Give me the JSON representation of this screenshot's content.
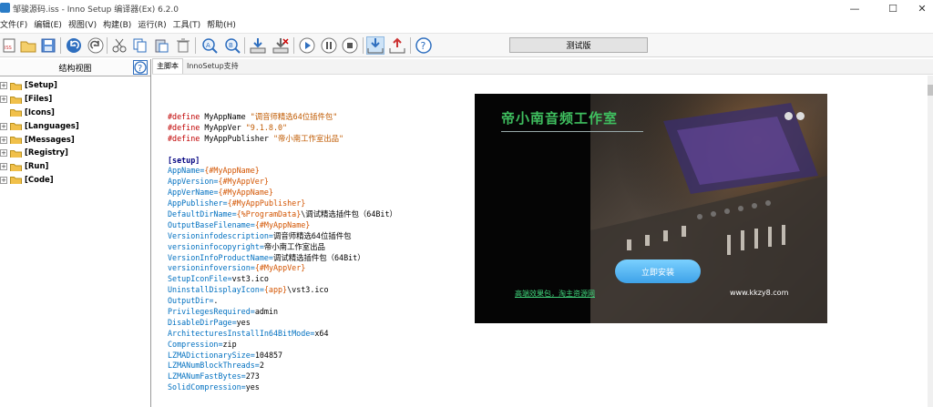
{
  "window": {
    "title": "邹骏源码.iss - Inno Setup 编译器(Ex) 6.2.0",
    "controls": {
      "minimize": "—",
      "maximize": "☐",
      "close": "✕"
    }
  },
  "menu": [
    "文件(F)",
    "编辑(E)",
    "视图(V)",
    "构建(B)",
    "运行(R)",
    "工具(T)",
    "帮助(H)"
  ],
  "toolbar": {
    "buttons": [
      "new-script-icon",
      "open-folder-icon",
      "save-icon",
      "undo-icon",
      "redo-icon",
      "cut-icon",
      "copy-icon",
      "paste-icon",
      "delete-icon",
      "find-icon",
      "replace-icon",
      "compile-icon",
      "stop-compile-icon",
      "run-icon",
      "pause-icon",
      "stop-icon",
      "download-icon",
      "upload-icon",
      "help-icon"
    ],
    "test_label": "测试版"
  },
  "structure": {
    "title": "结构视图",
    "items": [
      {
        "label": "[Setup]",
        "expandable": true
      },
      {
        "label": "[Files]",
        "expandable": true
      },
      {
        "label": "[Icons]",
        "expandable": false
      },
      {
        "label": "[Languages]",
        "expandable": true
      },
      {
        "label": "[Messages]",
        "expandable": true
      },
      {
        "label": "[Registry]",
        "expandable": true
      },
      {
        "label": "[Run]",
        "expandable": true
      },
      {
        "label": "[Code]",
        "expandable": true
      }
    ]
  },
  "tabs": [
    "主脚本",
    "InnoSetup支持"
  ],
  "code": {
    "defines": [
      {
        "kw": "#define",
        "name": " MyAppName ",
        "value": "\"调音师精选64位插件包\""
      },
      {
        "kw": "#define",
        "name": " MyAppVer ",
        "value": "\"9.1.8.0\""
      },
      {
        "kw": "#define",
        "name": " MyAppPublisher ",
        "value": "\"帝小南工作室出品\""
      }
    ],
    "section": "[setup]",
    "lines": [
      {
        "key": "AppName=",
        "const": "{#MyAppName}",
        "val": ""
      },
      {
        "key": "AppVersion=",
        "const": "{#MyAppVer}",
        "val": ""
      },
      {
        "key": "AppVerName=",
        "const": "{#MyAppName}",
        "val": ""
      },
      {
        "key": "AppPublisher=",
        "const": "{#MyAppPublisher}",
        "val": ""
      },
      {
        "key": "DefaultDirName=",
        "const": "{%ProgramData}",
        "val": "\\调试精选插件包（64Bit）"
      },
      {
        "key": "OutputBaseFilename=",
        "const": "{#MyAppName}",
        "val": ""
      },
      {
        "key": "Versioninfodescription=",
        "const": "",
        "val": "调音师精选64位插件包"
      },
      {
        "key": "versioninfocopyright=",
        "const": "",
        "val": "帝小南工作室出品"
      },
      {
        "key": "VersionInfoProductName=",
        "const": "",
        "val": "调试精选插件包（64Bit）"
      },
      {
        "key": "versioninfoversion=",
        "const": "{#MyAppVer}",
        "val": ""
      },
      {
        "key": "SetupIconFile=",
        "const": "",
        "val": "vst3.ico"
      },
      {
        "key": "UninstallDisplayIcon=",
        "const": "{app}",
        "val": "\\vst3.ico"
      },
      {
        "key": "OutputDir=",
        "const": "",
        "val": "."
      },
      {
        "key": "PrivilegesRequired=",
        "const": "",
        "val": "admin"
      },
      {
        "key": "DisableDirPage=",
        "const": "",
        "val": "yes"
      },
      {
        "key": "ArchitecturesInstallIn64BitMode=",
        "const": "",
        "val": "x64"
      },
      {
        "key": "Compression=",
        "const": "",
        "val": "zip"
      },
      {
        "key": "LZMADictionarySize=",
        "const": "",
        "val": "104857"
      },
      {
        "key": "LZMANumBlockThreads=",
        "const": "",
        "val": "2"
      },
      {
        "key": "LZMANumFastBytes=",
        "const": "",
        "val": "273"
      },
      {
        "key": "SolidCompression=",
        "const": "",
        "val": "yes"
      }
    ]
  },
  "preview": {
    "title": "帝小南音频工作室",
    "install_button": "立即安装",
    "link": "高端效果包，淘主资源网",
    "site": "www.kkzy8.com"
  },
  "colors": {
    "tree_folder": "#f1c04a",
    "accent_green": "#3fbf5f"
  }
}
